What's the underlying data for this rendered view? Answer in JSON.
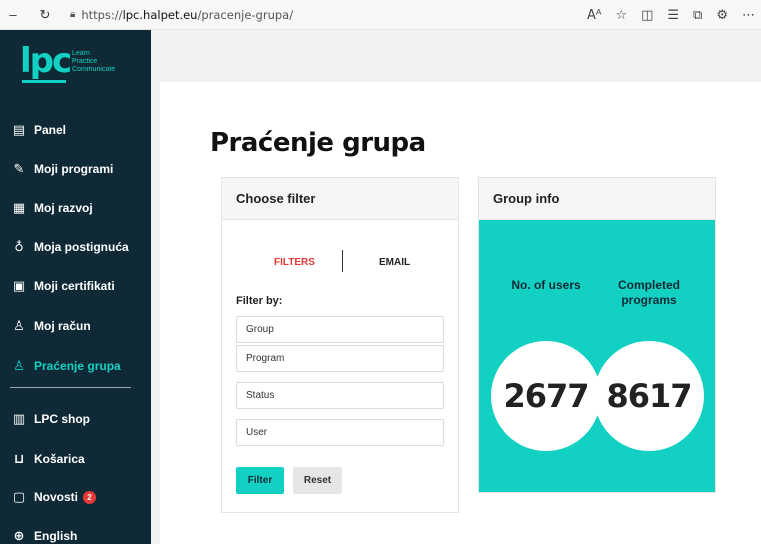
{
  "browser": {
    "url_prefix": "https://",
    "url_host": "lpc.halpet.eu",
    "url_path": "/pracenje-grupa/",
    "back_icon": "minus-icon",
    "refresh_icon": "refresh-icon"
  },
  "logo": {
    "mark": "lpc",
    "line1": "Learn",
    "line2": "Practice",
    "line3": "Communicate"
  },
  "sidebar": {
    "items": [
      {
        "label": "Panel",
        "icon": "panel-icon",
        "glyph": "▤"
      },
      {
        "label": "Moji programi",
        "icon": "programs-icon",
        "glyph": "✎"
      },
      {
        "label": "Moj razvoj",
        "icon": "development-icon",
        "glyph": "▦"
      },
      {
        "label": "Moja postignuća",
        "icon": "medal-icon",
        "glyph": "♁"
      },
      {
        "label": "Moji certifikati",
        "icon": "certificate-icon",
        "glyph": "▣"
      },
      {
        "label": "Moj račun",
        "icon": "user-icon",
        "glyph": "♙"
      },
      {
        "label": "Praćenje grupa",
        "icon": "group-icon",
        "glyph": "♙"
      },
      {
        "label": "LPC shop",
        "icon": "shop-icon",
        "glyph": "▥"
      },
      {
        "label": "Košarica",
        "icon": "cart-icon",
        "glyph": "⊔"
      },
      {
        "label": "Novosti",
        "icon": "news-icon",
        "glyph": "▢"
      },
      {
        "label": "English",
        "icon": "globe-icon",
        "glyph": "⊕"
      }
    ],
    "news_badge": "2"
  },
  "main": {
    "title": "Praćenje grupa",
    "filter_card": {
      "title": "Choose filter",
      "tab_filters": "FILTERS",
      "tab_email": "EMAIL",
      "filter_by": "Filter by:",
      "fields": [
        "Group",
        "Program",
        "Status",
        "User"
      ],
      "filter_button": "Filter",
      "reset_button": "Reset"
    },
    "info_card": {
      "title": "Group info",
      "users_label": "No. of users",
      "completed_label_1": "Completed",
      "completed_label_2": "programs",
      "users_value": "2677",
      "completed_value": "8617"
    }
  },
  "colors": {
    "sidebar_bg": "#0f2a36",
    "accent": "#12d1c2",
    "tab_active": "#e53935"
  }
}
